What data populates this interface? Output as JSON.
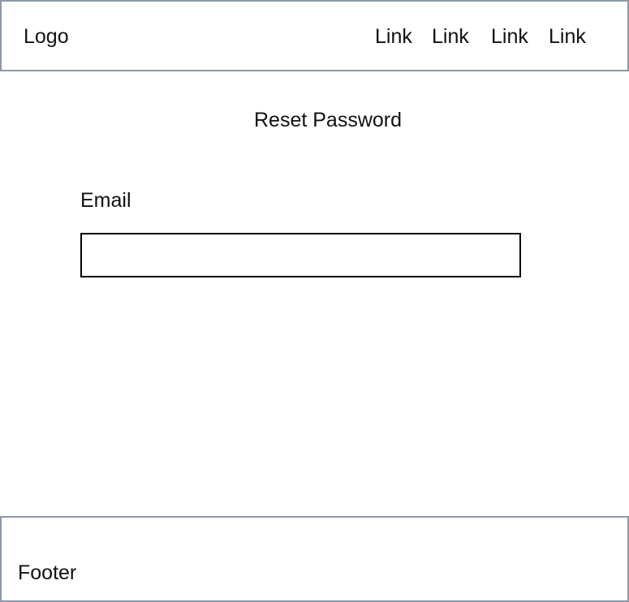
{
  "header": {
    "logo": "Logo",
    "links": [
      "Link",
      "Link",
      "Link",
      "Link"
    ]
  },
  "main": {
    "title": "Reset Password",
    "email_label": "Email",
    "email_value": "",
    "email_placeholder": ""
  },
  "footer": {
    "text": "Footer"
  },
  "colors": {
    "border": "#8e98a8",
    "input_border": "#000000",
    "text": "#111111",
    "background": "#ffffff"
  }
}
